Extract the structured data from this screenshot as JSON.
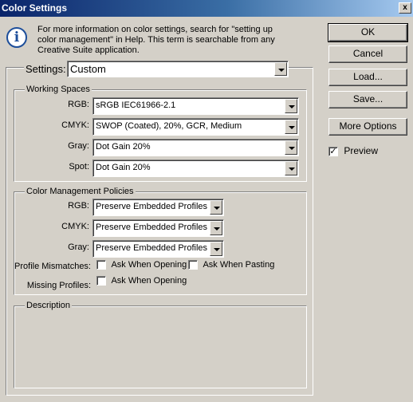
{
  "window": {
    "title": "Color Settings",
    "close_glyph": "x"
  },
  "info": {
    "icon": "info-icon",
    "glyph": "i",
    "text": "For more information on color settings, search for \"setting up color management\" in Help. This term is searchable from any Creative Suite application."
  },
  "buttons": {
    "ok": "OK",
    "cancel": "Cancel",
    "load": "Load...",
    "save": "Save...",
    "more_options": "More Options"
  },
  "preview": {
    "label": "Preview",
    "checked": true,
    "mark": "✓"
  },
  "settings": {
    "label": "Settings:",
    "value": "Custom"
  },
  "working_spaces": {
    "title": "Working Spaces",
    "rgb": {
      "label": "RGB:",
      "value": "sRGB IEC61966-2.1"
    },
    "cmyk": {
      "label": "CMYK:",
      "value": "SWOP (Coated), 20%, GCR, Medium"
    },
    "gray": {
      "label": "Gray:",
      "value": "Dot Gain 20%"
    },
    "spot": {
      "label": "Spot:",
      "value": "Dot Gain 20%"
    }
  },
  "policies": {
    "title": "Color Management Policies",
    "rgb": {
      "label": "RGB:",
      "value": "Preserve Embedded Profiles"
    },
    "cmyk": {
      "label": "CMYK:",
      "value": "Preserve Embedded Profiles"
    },
    "gray": {
      "label": "Gray:",
      "value": "Preserve Embedded Profiles"
    },
    "profile_mismatches": {
      "label": "Profile Mismatches:",
      "ask_opening": "Ask When Opening",
      "ask_pasting": "Ask When Pasting"
    },
    "missing_profiles": {
      "label": "Missing Profiles:",
      "ask_opening": "Ask When Opening"
    }
  },
  "description": {
    "title": "Description"
  }
}
